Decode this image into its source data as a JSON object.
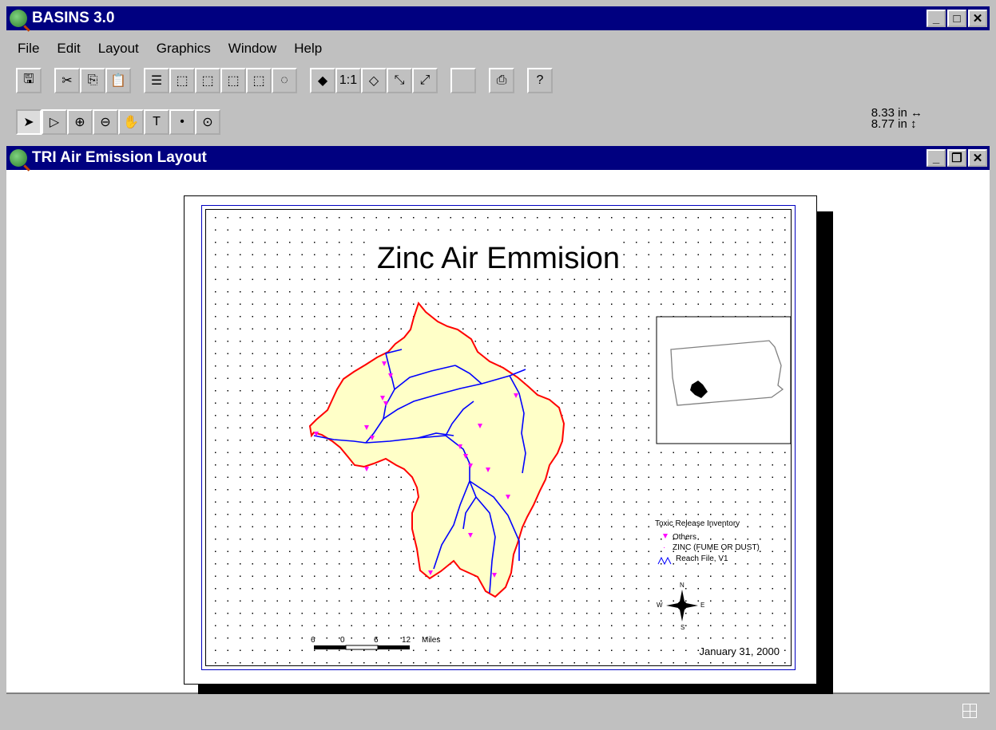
{
  "app": {
    "title": "BASINS 3.0"
  },
  "menu": [
    "File",
    "Edit",
    "Layout",
    "Graphics",
    "Window",
    "Help"
  ],
  "size_readout": {
    "width": "8.33 in",
    "height": "8.77 in"
  },
  "layout_window": {
    "title": "TRI Air Emission Layout"
  },
  "map": {
    "title": "Zinc Air Emmision",
    "legend_title": "Toxic Release Inventory",
    "legend_items": [
      "Others",
      "ZINC (FUME OR DUST)",
      "Reach File, V1"
    ],
    "scale_labels": [
      "6",
      "0",
      "6",
      "12",
      "Miles"
    ],
    "date": "January 31, 2000",
    "north_labels": [
      "N",
      "S",
      "W",
      "E"
    ]
  },
  "colors": {
    "titlebar": "#000080",
    "boundary": "#ff0000",
    "watershed_fill": "#ffffc8",
    "streams": "#0000ff",
    "sites": "#ff00ff"
  }
}
